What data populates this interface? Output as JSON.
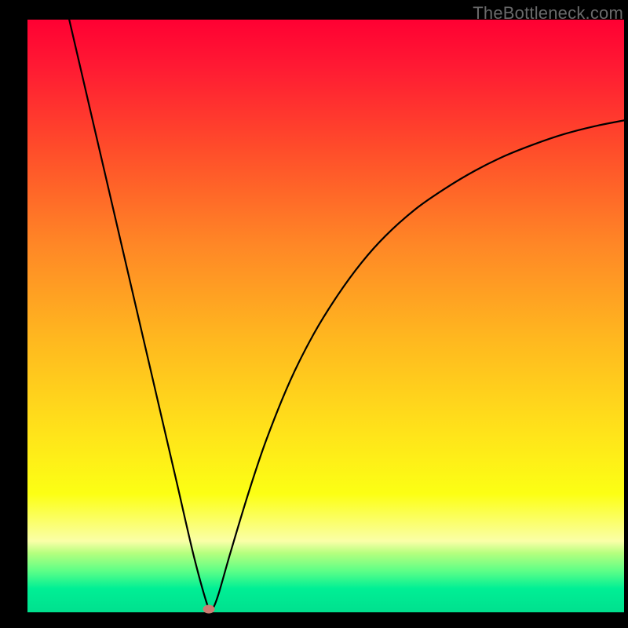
{
  "watermark": "TheBottleneck.com",
  "chart_data": {
    "type": "line",
    "title": "",
    "xlabel": "",
    "ylabel": "",
    "xlim": [
      0,
      100
    ],
    "ylim": [
      0,
      100
    ],
    "grid": false,
    "background_gradient": {
      "top": "#ff0033",
      "bottom": "#00e08e",
      "stops": [
        "red",
        "orange",
        "yellow",
        "green"
      ]
    },
    "series": [
      {
        "name": "bottleneck-curve",
        "color": "#000000",
        "x": [
          7,
          10,
          13,
          16,
          19,
          22,
          25,
          28,
          30.4,
          31,
          32,
          34,
          37,
          40,
          44,
          48,
          52,
          56,
          60,
          65,
          70,
          75,
          80,
          85,
          90,
          95,
          100
        ],
        "y": [
          100,
          87,
          74,
          61,
          48,
          35,
          22,
          9,
          0.5,
          0.5,
          3,
          10,
          20,
          29,
          39,
          47,
          53.5,
          59,
          63.5,
          68,
          71.5,
          74.5,
          77,
          79,
          80.7,
          82,
          83
        ]
      }
    ],
    "marker": {
      "name": "optimal-point",
      "x": 30.4,
      "y": 0.5,
      "color": "#cc7c72",
      "shape": "ellipse"
    }
  }
}
